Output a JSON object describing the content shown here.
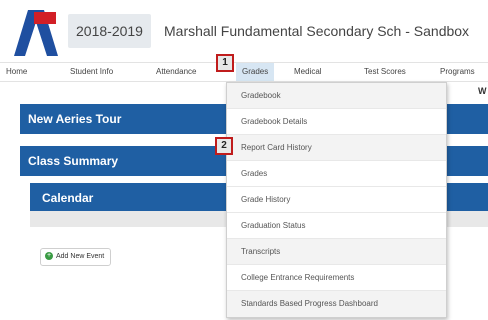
{
  "header": {
    "school_year": "2018-2019",
    "school_name": "Marshall Fundamental Secondary Sch - Sandbox",
    "logo_icon": "aeries-a-logo",
    "logo_colors": {
      "blue": "#1f4fa0",
      "red": "#d21f26"
    }
  },
  "nav": {
    "items": [
      {
        "label": "Home"
      },
      {
        "label": "Student Info"
      },
      {
        "label": "Attendance"
      },
      {
        "label": "Grades"
      },
      {
        "label": "Medical"
      },
      {
        "label": "Test Scores"
      },
      {
        "label": "Programs"
      }
    ],
    "active": "Grades",
    "active_color": "#d7e6f3"
  },
  "main": {
    "bars": [
      {
        "label": "New Aeries Tour"
      },
      {
        "label": "Class Summary"
      },
      {
        "label": "Calendar"
      }
    ],
    "bar_color": "#1f5fa3",
    "add_event_label": "Add New Event",
    "right_edge_partial": "W"
  },
  "dropdown": {
    "items": [
      {
        "label": "Gradebook"
      },
      {
        "label": "Gradebook Details"
      },
      {
        "label": "Report Card History"
      },
      {
        "label": "Grades"
      },
      {
        "label": "Grade History"
      },
      {
        "label": "Graduation Status"
      },
      {
        "label": "Transcripts"
      },
      {
        "label": "College Entrance Requirements"
      },
      {
        "label": "Standards Based Progress Dashboard"
      }
    ]
  },
  "callouts": [
    {
      "label": "1"
    },
    {
      "label": "2"
    }
  ],
  "callout_border_color": "#c01c1c"
}
